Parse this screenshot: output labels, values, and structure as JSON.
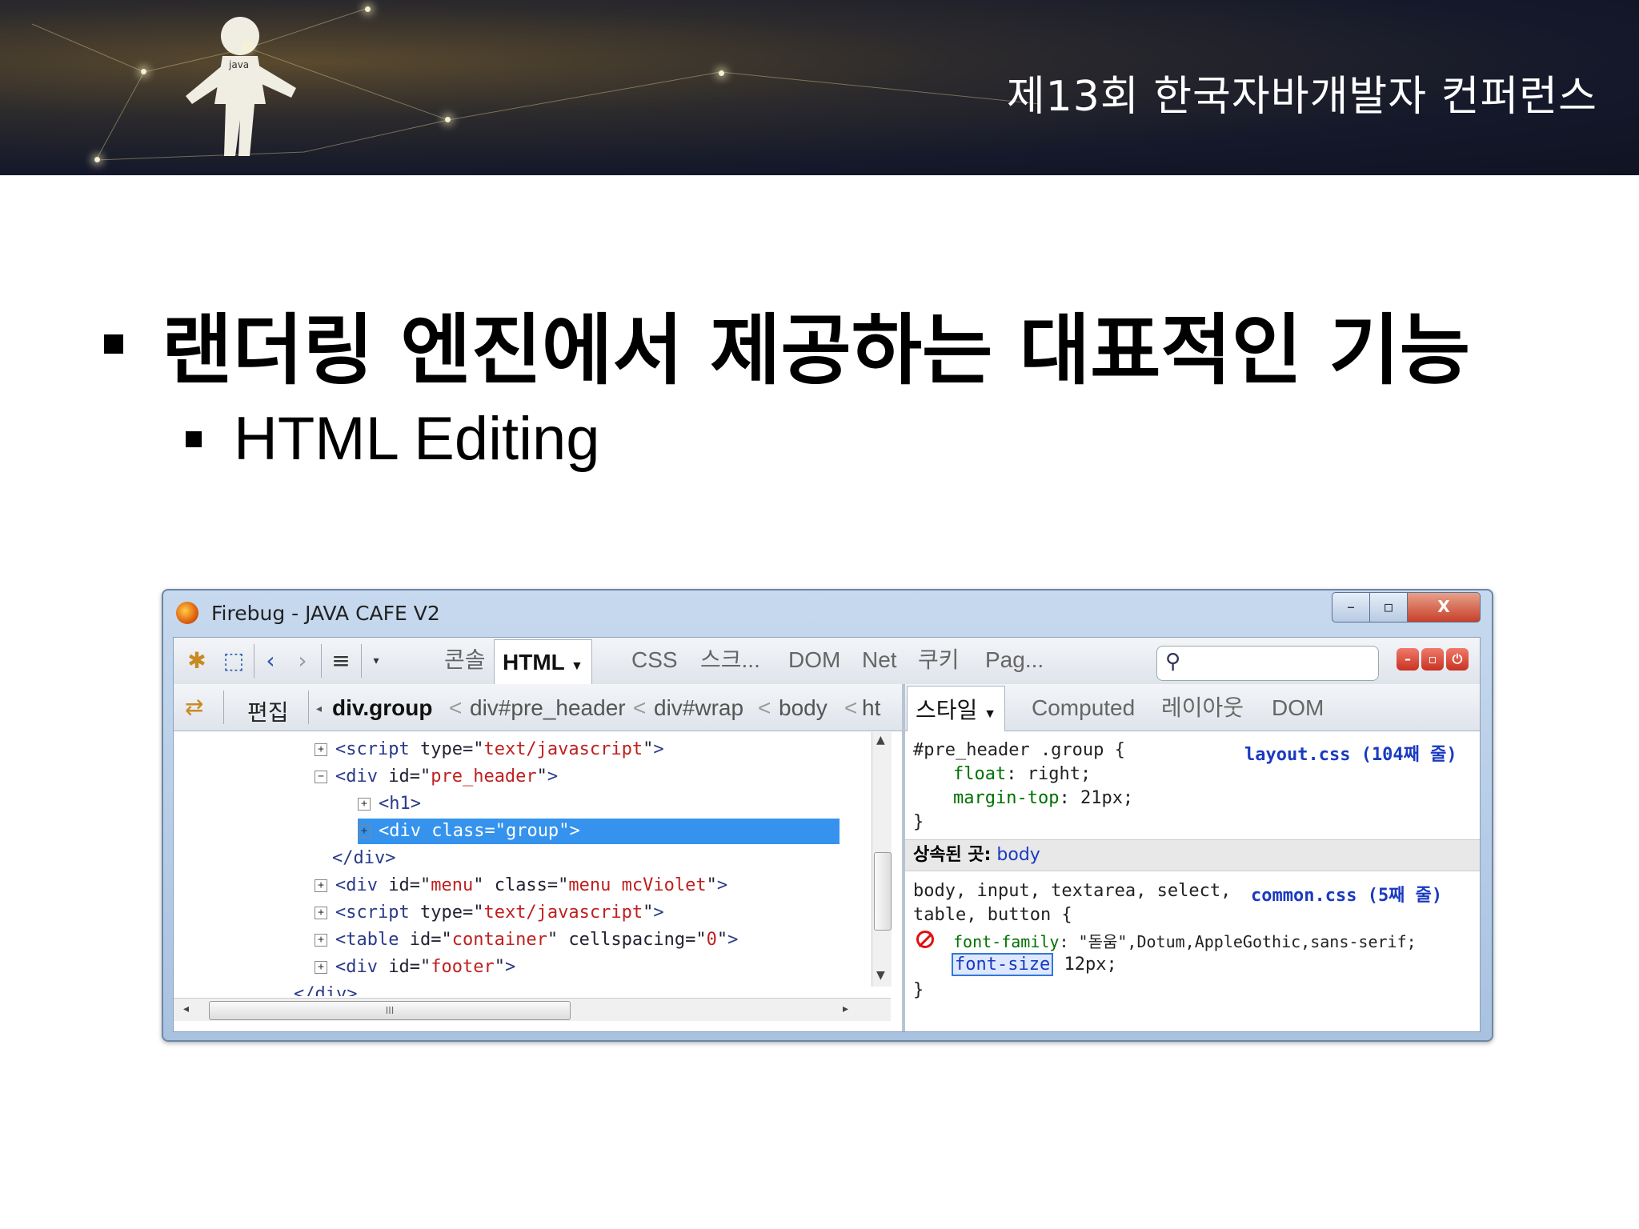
{
  "slide": {
    "conference": "제13회 한국자바개발자 컨퍼런스",
    "heading": "랜더링 엔진에서 제공하는 대표적인 기능",
    "subheading": "HTML Editing"
  },
  "window": {
    "title": "Firebug - JAVA CAFE V2",
    "buttons": {
      "minimize": "–",
      "maximize": "▫",
      "close": "X"
    }
  },
  "toolbar": {
    "tabs": [
      "콘솔",
      "HTML",
      "CSS",
      "스크...",
      "DOM",
      "Net",
      "쿠키",
      "Pag..."
    ],
    "active_tab": "HTML",
    "search_placeholder": ""
  },
  "breadcrumb": {
    "edit_label": "편집",
    "items": [
      "div.group",
      "div#pre_header",
      "div#wrap",
      "body",
      "ht"
    ]
  },
  "html_tree": [
    {
      "toggle": "+",
      "tag_open": "<script ",
      "attrs": [
        {
          "name": "type",
          "value": "text/javascript"
        }
      ],
      "tag_close": ">"
    },
    {
      "toggle": "−",
      "tag_open": "<div ",
      "attrs": [
        {
          "name": "id",
          "value": "pre_header"
        }
      ],
      "tag_close": ">"
    },
    {
      "toggle": "+",
      "tag_open": "<h1>",
      "attrs": [],
      "tag_close": ""
    },
    {
      "toggle": "+",
      "tag_open": "<div ",
      "attrs": [
        {
          "name": "class",
          "value": "group"
        }
      ],
      "tag_close": ">",
      "selected": true
    },
    {
      "toggle": "",
      "tag_open": "</div>",
      "attrs": [],
      "tag_close": ""
    },
    {
      "toggle": "+",
      "tag_open": "<div ",
      "attrs": [
        {
          "name": "id",
          "value": "menu"
        },
        {
          "name": "class",
          "value": "menu mcViolet"
        }
      ],
      "tag_close": ">"
    },
    {
      "toggle": "+",
      "tag_open": "<script ",
      "attrs": [
        {
          "name": "type",
          "value": "text/javascript"
        }
      ],
      "tag_close": ">"
    },
    {
      "toggle": "+",
      "tag_open": "<table ",
      "attrs": [
        {
          "name": "id",
          "value": "container"
        },
        {
          "name": "cellspacing",
          "value": "0"
        }
      ],
      "tag_close": ">"
    },
    {
      "toggle": "+",
      "tag_open": "<div ",
      "attrs": [
        {
          "name": "id",
          "value": "footer"
        }
      ],
      "tag_close": ">"
    },
    {
      "toggle": "",
      "tag_open": "</div>",
      "attrs": [],
      "tag_close": ""
    }
  ],
  "side_tabs": {
    "items": [
      "스타일",
      "Computed",
      "레이아웃",
      "DOM"
    ],
    "active": "스타일"
  },
  "styles": {
    "rule1": {
      "selector": "#pre_header .group {",
      "source": "layout.css (104째 줄)",
      "props": [
        {
          "name": "float",
          "value": "right;"
        },
        {
          "name": "margin-top",
          "value": "21px;"
        }
      ],
      "close": "}"
    },
    "inherited_label": "상속된 곳:",
    "inherited_from": "body",
    "rule2": {
      "selector_line1": "body, input, textarea, select,",
      "selector_line2": "table, button {",
      "source": "common.css (5째 줄)",
      "prop1_name": "font-family",
      "prop1_value": "\"돋움\",Dotum,AppleGothic,sans-serif;",
      "prop2_name": "font-size",
      "prop2_value": "12px;",
      "close": "}"
    }
  },
  "colors": {
    "selection": "#3593ed",
    "attr_value": "#c02020",
    "css_prop": "#007000",
    "link": "#1a3ac0"
  }
}
